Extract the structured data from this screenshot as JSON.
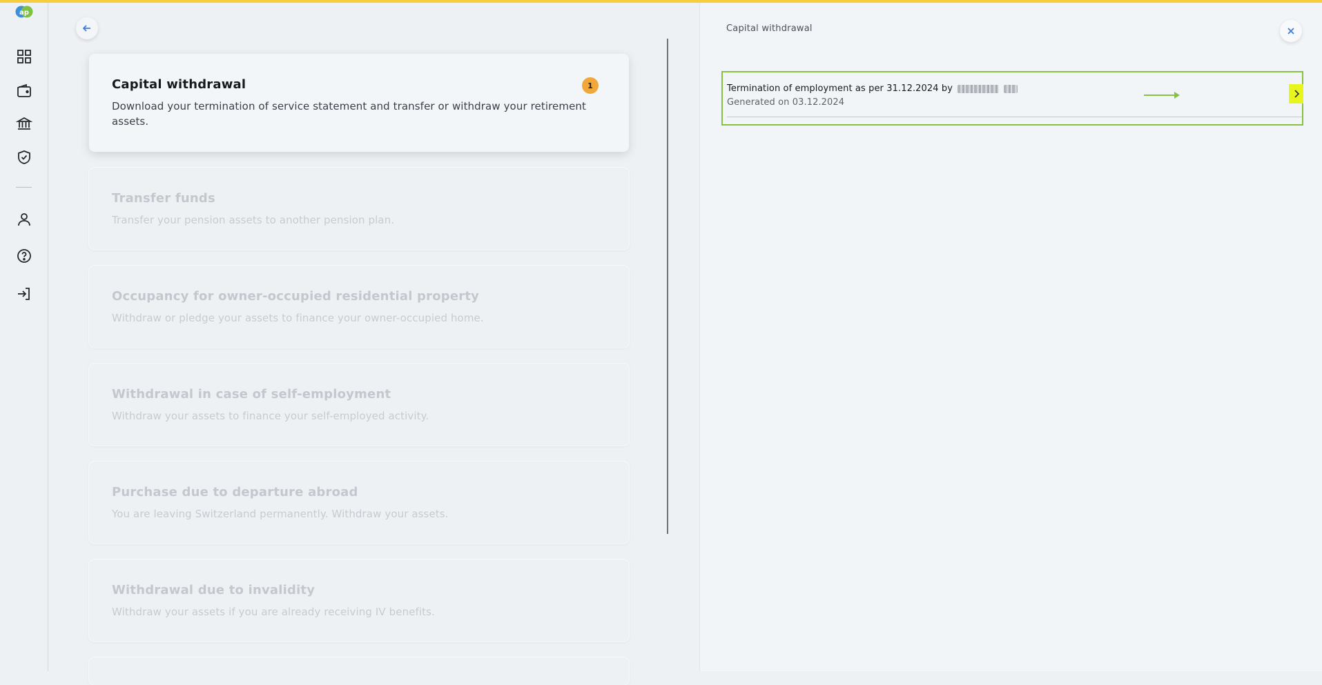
{
  "app": {
    "logo_text": "ap",
    "accent_color": "#f5cd3d",
    "highlight_color": "#86c13f"
  },
  "sidebar": {
    "items": [
      {
        "icon": "dashboard-icon"
      },
      {
        "icon": "wallet-icon"
      },
      {
        "icon": "bank-icon"
      },
      {
        "icon": "shield-check-icon"
      },
      {
        "icon": "user-icon"
      },
      {
        "icon": "help-icon"
      },
      {
        "icon": "logout-icon"
      }
    ]
  },
  "main": {
    "cards": [
      {
        "title": "Capital withdrawal",
        "description": "Download your termination of service statement and transfer or withdraw your retirement assets.",
        "badge": "1",
        "active": true
      },
      {
        "title": "Transfer funds",
        "description": "Transfer your pension assets to another pension plan.",
        "active": false
      },
      {
        "title": "Occupancy for owner-occupied residential property",
        "description": "Withdraw or pledge your assets to finance your owner-occupied home.",
        "active": false
      },
      {
        "title": "Withdrawal in case of self-employment",
        "description": "Withdraw your assets to finance your self-employed activity.",
        "active": false
      },
      {
        "title": "Purchase due to departure abroad",
        "description": "You are leaving Switzerland permanently. Withdraw your assets.",
        "active": false
      },
      {
        "title": "Withdrawal due to invalidity",
        "description": "Withdraw your assets if you are already receiving IV benefits.",
        "active": false
      }
    ]
  },
  "panel": {
    "title": "Capital withdrawal",
    "document": {
      "title": "Termination of employment as per 31.12.2024 by",
      "generated": "Generated on 03.12.2024"
    }
  }
}
